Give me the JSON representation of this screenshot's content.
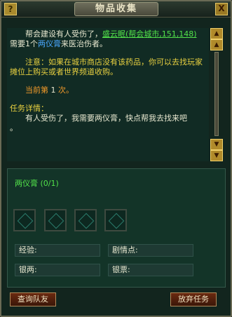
{
  "window": {
    "title": "物品收集",
    "help": "?",
    "close": "X"
  },
  "quest": {
    "line1a": "帮会建设有人受伤了，",
    "npc": "盛云眠(帮会城市,151,148)",
    "line2a": "需要1个",
    "item_link": "两仪膏",
    "line2b": "来医治伤者。",
    "note": "注意：如果在城市商店没有该药品，你可以去找玩家摊位上购买或者世界频道收购。",
    "current_prefix": "当前第",
    "current_count": "1",
    "current_suffix": "次。",
    "detail_heading": "任务详情：",
    "detail": "有人受伤了，我需要两仪膏，快点帮我去找来吧",
    "dot": "。"
  },
  "items_needed": "两仪膏 (0/1)",
  "fields": {
    "exp": "经验:",
    "plot": "剧情点:",
    "silver": "银两:",
    "ticket": "银票:"
  },
  "buttons": {
    "query_team": "查询队友",
    "abandon": "放弃任务"
  },
  "colors": {
    "npc_link": "#52e24a",
    "item_link": "#4aa8ff",
    "note": "#e8d040",
    "count": "#f29a2a"
  }
}
